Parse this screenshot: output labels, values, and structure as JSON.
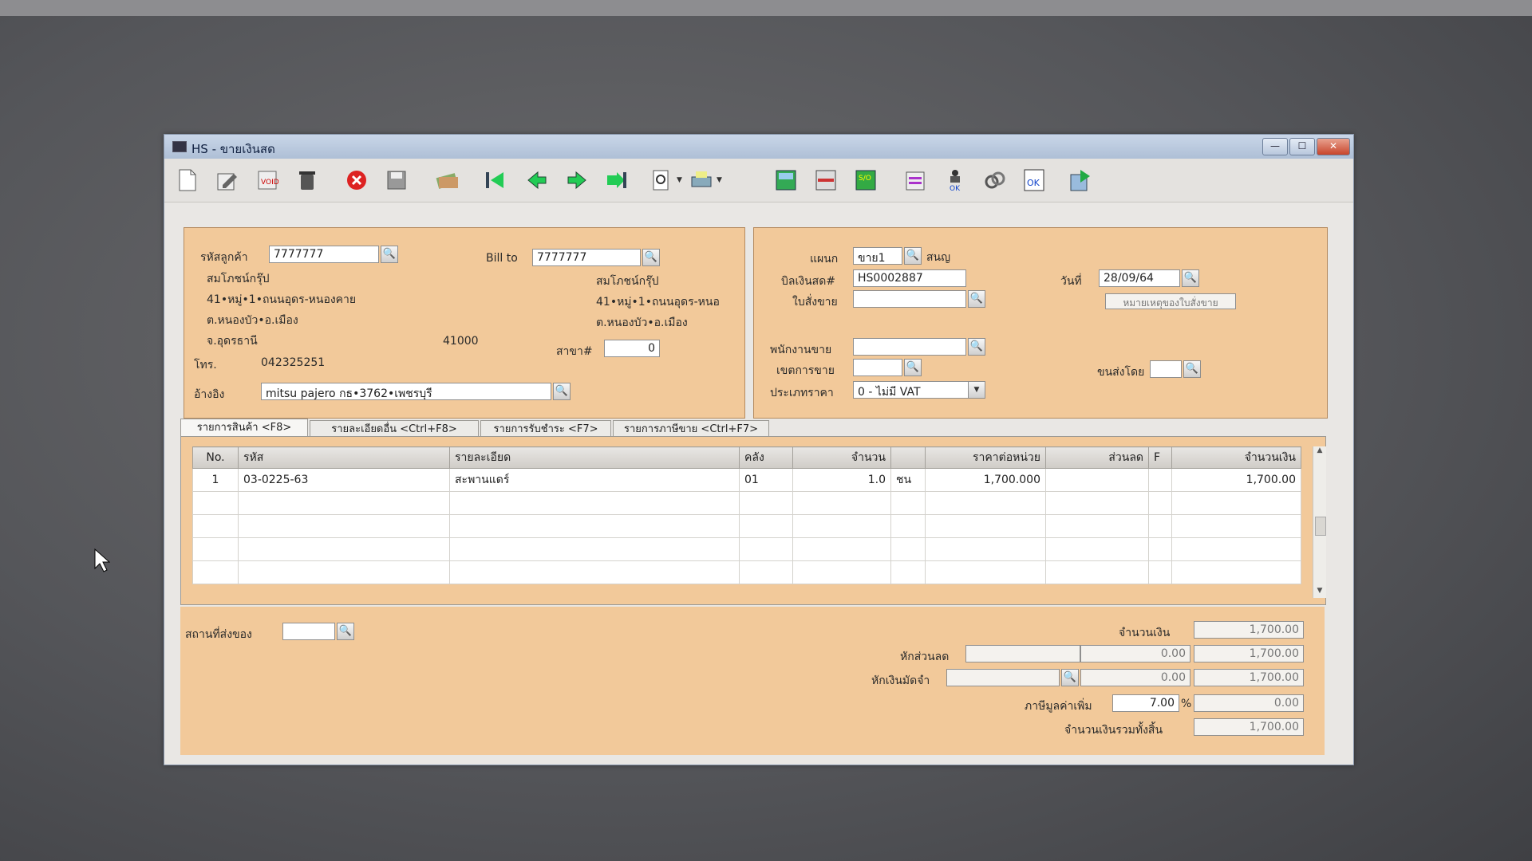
{
  "window": {
    "title": "HS - ขายเงินสด",
    "min_label": "—",
    "max_label": "☐",
    "close_label": "✕"
  },
  "toolbar": {
    "icons": [
      "new-document-icon",
      "edit-icon",
      "void-icon",
      "delete-trash-icon",
      "cancel-icon",
      "save-icon",
      "money-icon",
      "first-record-icon",
      "previous-record-icon",
      "next-record-icon",
      "last-record-icon",
      "preview-icon",
      "print-icon",
      "calculator-icon",
      "register-icon",
      "sale-order-icon",
      "report-icon",
      "approve-icon",
      "attach-icon",
      "ok-doc-icon",
      "export-icon"
    ]
  },
  "customer": {
    "code_label": "รหัสลูกค้า",
    "code": "7777777",
    "name": "สมโภชน์กรุ๊ป",
    "addr1": "41•หมู่•1•ถนนอุดร-หนองคาย",
    "addr2": "ต.หนองบัว•อ.เมือง",
    "province": "จ.อุดรธานี",
    "zip": "41000",
    "phone_label": "โทร.",
    "phone": "042325251",
    "ref_label": "อ้างอิง",
    "ref": "mitsu pajero กธ•3762•เพชรบุรี"
  },
  "billto": {
    "label": "Bill to",
    "code": "7777777",
    "name": "สมโภชน์กรุ๊ป",
    "addr1": "41•หมู่•1•ถนนอุดร-หนอ",
    "addr2": "ต.หนองบัว•อ.เมือง",
    "branch_label": "สาขา#",
    "branch": "0"
  },
  "doc": {
    "dept_label": "แผนก",
    "dept": "ขาย1",
    "dept_name": "สนญ",
    "bill_label": "บิลเงินสด#",
    "bill_no": "HS0002887",
    "date_label": "วันที่",
    "date": "28/09/64",
    "so_label": "ใบสั่งขาย",
    "so": "",
    "note_button": "หมายเหตุของใบสั่งขาย",
    "salesman_label": "พนักงานขาย",
    "salesman": "",
    "area_label": "เขตการขาย",
    "area": "",
    "ship_by_label": "ขนส่งโดย",
    "ship_by": "",
    "price_type_label": "ประเภทราคา",
    "price_type": "0 - ไม่มี VAT"
  },
  "tabs": [
    {
      "label": "รายการสินค้า <F8>",
      "active": true
    },
    {
      "label": "รายละเอียดอื่น <Ctrl+F8>",
      "active": false
    },
    {
      "label": "รายการรับชำระ <F7>",
      "active": false
    },
    {
      "label": "รายการภาษีขาย <Ctrl+F7>",
      "active": false
    }
  ],
  "grid": {
    "headers": {
      "no": "No.",
      "code": "รหัส",
      "desc": "รายละเอียด",
      "wh": "คลัง",
      "qty": "จำนวน",
      "unit": "",
      "price": "ราคาต่อหน่วย",
      "disc": "ส่วนลด",
      "f": "F",
      "amount": "จำนวนเงิน"
    },
    "rows": [
      {
        "no": "1",
        "code": "03-0225-63",
        "desc": "สะพานแดร์",
        "wh": "01",
        "qty": "1.0",
        "unit": "ชน",
        "price": "1,700.000",
        "disc": "",
        "f": "",
        "amount": "1,700.00"
      }
    ]
  },
  "footer": {
    "ship_place_label": "สถานที่ส่งของ",
    "ship_place": "",
    "amount_label": "จำนวนเงิน",
    "amount": "1,700.00",
    "discount_label": "หักส่วนลด",
    "discount_text": "",
    "discount_value": "0.00",
    "after_discount": "1,700.00",
    "deposit_label": "หักเงินมัดจำ",
    "deposit_text": "",
    "deposit_value": "0.00",
    "after_deposit": "1,700.00",
    "vat_label": "ภาษีมูลค่าเพิ่ม",
    "vat_rate": "7.00",
    "vat_pct": "%",
    "vat_amount": "0.00",
    "total_label": "จำนวนเงินรวมทั้งสิ้น",
    "total": "1,700.00"
  }
}
